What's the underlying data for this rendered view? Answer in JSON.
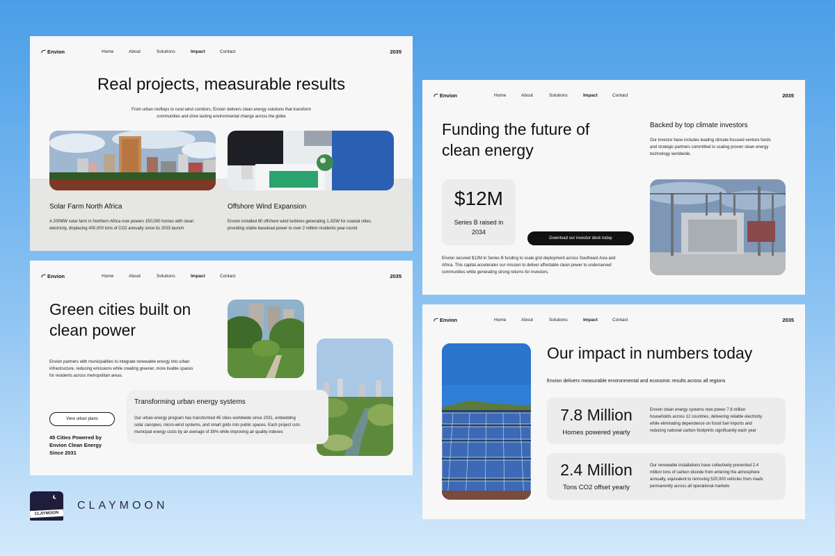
{
  "nav": {
    "logo": "Envion",
    "links": [
      "Home",
      "About",
      "Solutions",
      "Impact",
      "Contact"
    ],
    "year": "2035"
  },
  "panel1": {
    "title": "Real projects, measurable results",
    "subtitle_line1": "From urban rooftops to rural wind corridors, Envion delivers clean energy solutions that transform",
    "subtitle_line2": "communities and drive lasting environmental change across the globe",
    "project1": {
      "title": "Solar Farm North Africa",
      "desc_line1": "A 200MW solar farm in Northern Africa now powers 150,000 homes with clean",
      "desc_line2": "electricity, displacing 400,000 tons of CO2 annually since its 2033 launch"
    },
    "project2": {
      "title": "Offshore Wind Expansion",
      "desc_line1": "Envion installed 80 offshore wind turbines generating 1.2GW for coastal cities,",
      "desc_line2": "providing stable baseload power to over 2 million residents year-round"
    }
  },
  "panel2": {
    "title_line1": "Funding the future of",
    "title_line2": "clean energy",
    "investors_title": "Backed by top climate investors",
    "investors_line1": "Our investor base includes leading climate-focused venture funds",
    "investors_line2": "and strategic partners committed to scaling proven clean energy",
    "investors_line3": "technology worldwide.",
    "stat_value": "$12M",
    "stat_label_line1": "Series B raised in",
    "stat_label_line2": "2034",
    "cta": "Download our investor deck today",
    "body_line1": "Envion secured $12M in Series B funding to scale grid deployment across Southeast Asia and",
    "body_line2": "Africa. This capital accelerates our mission to deliver affordable clean power to underserved",
    "body_line3": "communities while generating strong returns for investors."
  },
  "panel3": {
    "title_line1": "Green cities built on",
    "title_line2": "clean power",
    "body_line1": "Envion partners with municipalities to integrate renewable energy into urban",
    "body_line2": "infrastructure, reducing emissions while creating greener, more livable spaces",
    "body_line3": "for residents across metropolitan areas.",
    "cta": "View urban plans",
    "stat_line1": "45 Cities Powered by",
    "stat_line2": "Envion Clean Energy",
    "stat_line3": "Since 2031",
    "box_title": "Transforming urban energy systems",
    "box_line1": "Our urban energy program has transformed 45 cities worldwide since 2031, embedding",
    "box_line2": "solar canopies, micro-wind systems, and smart grids into public spaces. Each project cuts",
    "box_line3": "municipal energy costs by an average of 38% while improving air quality indexes"
  },
  "panel4": {
    "title": "Our impact in numbers today",
    "subtitle": "Envion delivers measurable environmental and economic results across all regions",
    "stat1_value": "7.8 Million",
    "stat1_label": "Homes powered yearly",
    "stat1_line1": "Envion clean energy systems now power 7.8 million",
    "stat1_line2": "households across 12 countries, delivering reliable electricity",
    "stat1_line3": "while eliminating dependence on fossil fuel imports and",
    "stat1_line4": "reducing national carbon footprints significantly each year",
    "stat2_value": "2.4 Million",
    "stat2_label": "Tons CO2 offset yearly",
    "stat2_line1": "Our renewable installations have collectively prevented 2.4",
    "stat2_line2": "million tons of carbon dioxide from entering the atmosphere",
    "stat2_line3": "annually, equivalent to removing 520,000 vehicles from roads",
    "stat2_line4": "permanently across all operational markets"
  },
  "brand": {
    "name": "CLAYMOON",
    "badge_text": "CLAYMOON"
  }
}
